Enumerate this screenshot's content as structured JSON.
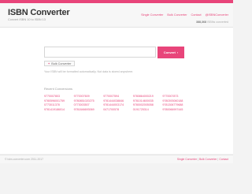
{
  "brand": {
    "title": "ISBN Converter",
    "tagline": "Convert ISBN 10 to ISBN 13",
    "accent_color": "#e8457a"
  },
  "nav": {
    "items": [
      "Single Converter",
      "Bulk Converter",
      "Contact",
      "@ISBNConverter"
    ]
  },
  "stats": {
    "count": "388,368",
    "suffix": "ISBNs converted"
  },
  "search": {
    "value": "",
    "placeholder": ""
  },
  "convert_button": {
    "label": "Convert",
    "icon": "chevron-right-icon"
  },
  "bulk_button": {
    "label": "Bulk Converter",
    "icon": "plus-icon"
  },
  "hint": "Your ISBN will be formatted automatically. Not data is stored anywhere.",
  "recent": {
    "title": "Recent Conversions",
    "items": [
      "9770007803",
      "9770007609",
      "9770007594",
      "9780864000219",
      "9770007873",
      "9780596001759",
      "9780851020275",
      "9781444038846",
      "9781014600035",
      "9780393060188",
      "0773011378",
      "0773003507",
      "9781444003174",
      "9780002005058",
      "9781306779688",
      "9781419186014",
      "9781846693069",
      "0471700578",
      "0191725314",
      "9780066997445"
    ]
  },
  "footer": {
    "copyright": "© isbn-converter.com 2011-2017",
    "links": [
      "Single Converter",
      "Bulk Converter",
      "Contact"
    ],
    "separator": " | "
  }
}
